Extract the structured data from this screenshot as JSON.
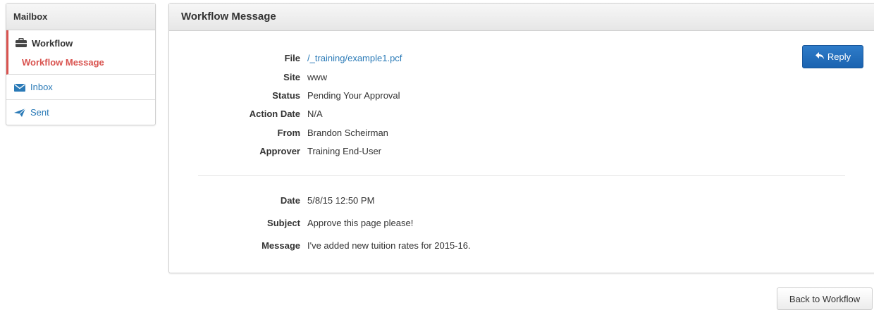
{
  "sidebar": {
    "title": "Mailbox",
    "workflow": {
      "label": "Workflow",
      "icon": "briefcase-icon"
    },
    "workflow_sub": {
      "label": "Workflow Message"
    },
    "inbox": {
      "label": "Inbox",
      "icon": "envelope-icon"
    },
    "sent": {
      "label": "Sent",
      "icon": "paper-plane-icon"
    }
  },
  "panel": {
    "title": "Workflow Message",
    "reply_label": "Reply",
    "fields": [
      {
        "label": "File",
        "value": "/_training/example1.pcf",
        "link": true
      },
      {
        "label": "Site",
        "value": "www"
      },
      {
        "label": "Status",
        "value": "Pending Your Approval"
      },
      {
        "label": "Action Date",
        "value": "N/A"
      },
      {
        "label": "From",
        "value": "Brandon Scheirman"
      },
      {
        "label": "Approver",
        "value": "Training End-User"
      }
    ],
    "message": [
      {
        "label": "Date",
        "value": "5/8/15 12:50 PM"
      },
      {
        "label": "Subject",
        "value": "Approve this page please!"
      },
      {
        "label": "Message",
        "value": "I've added new tuition rates for 2015-16."
      }
    ]
  },
  "footer": {
    "back_label": "Back to Workflow"
  },
  "colors": {
    "accent": "#2a7ab7",
    "active": "#d9534f",
    "primary_button": "#1f6fbd"
  }
}
